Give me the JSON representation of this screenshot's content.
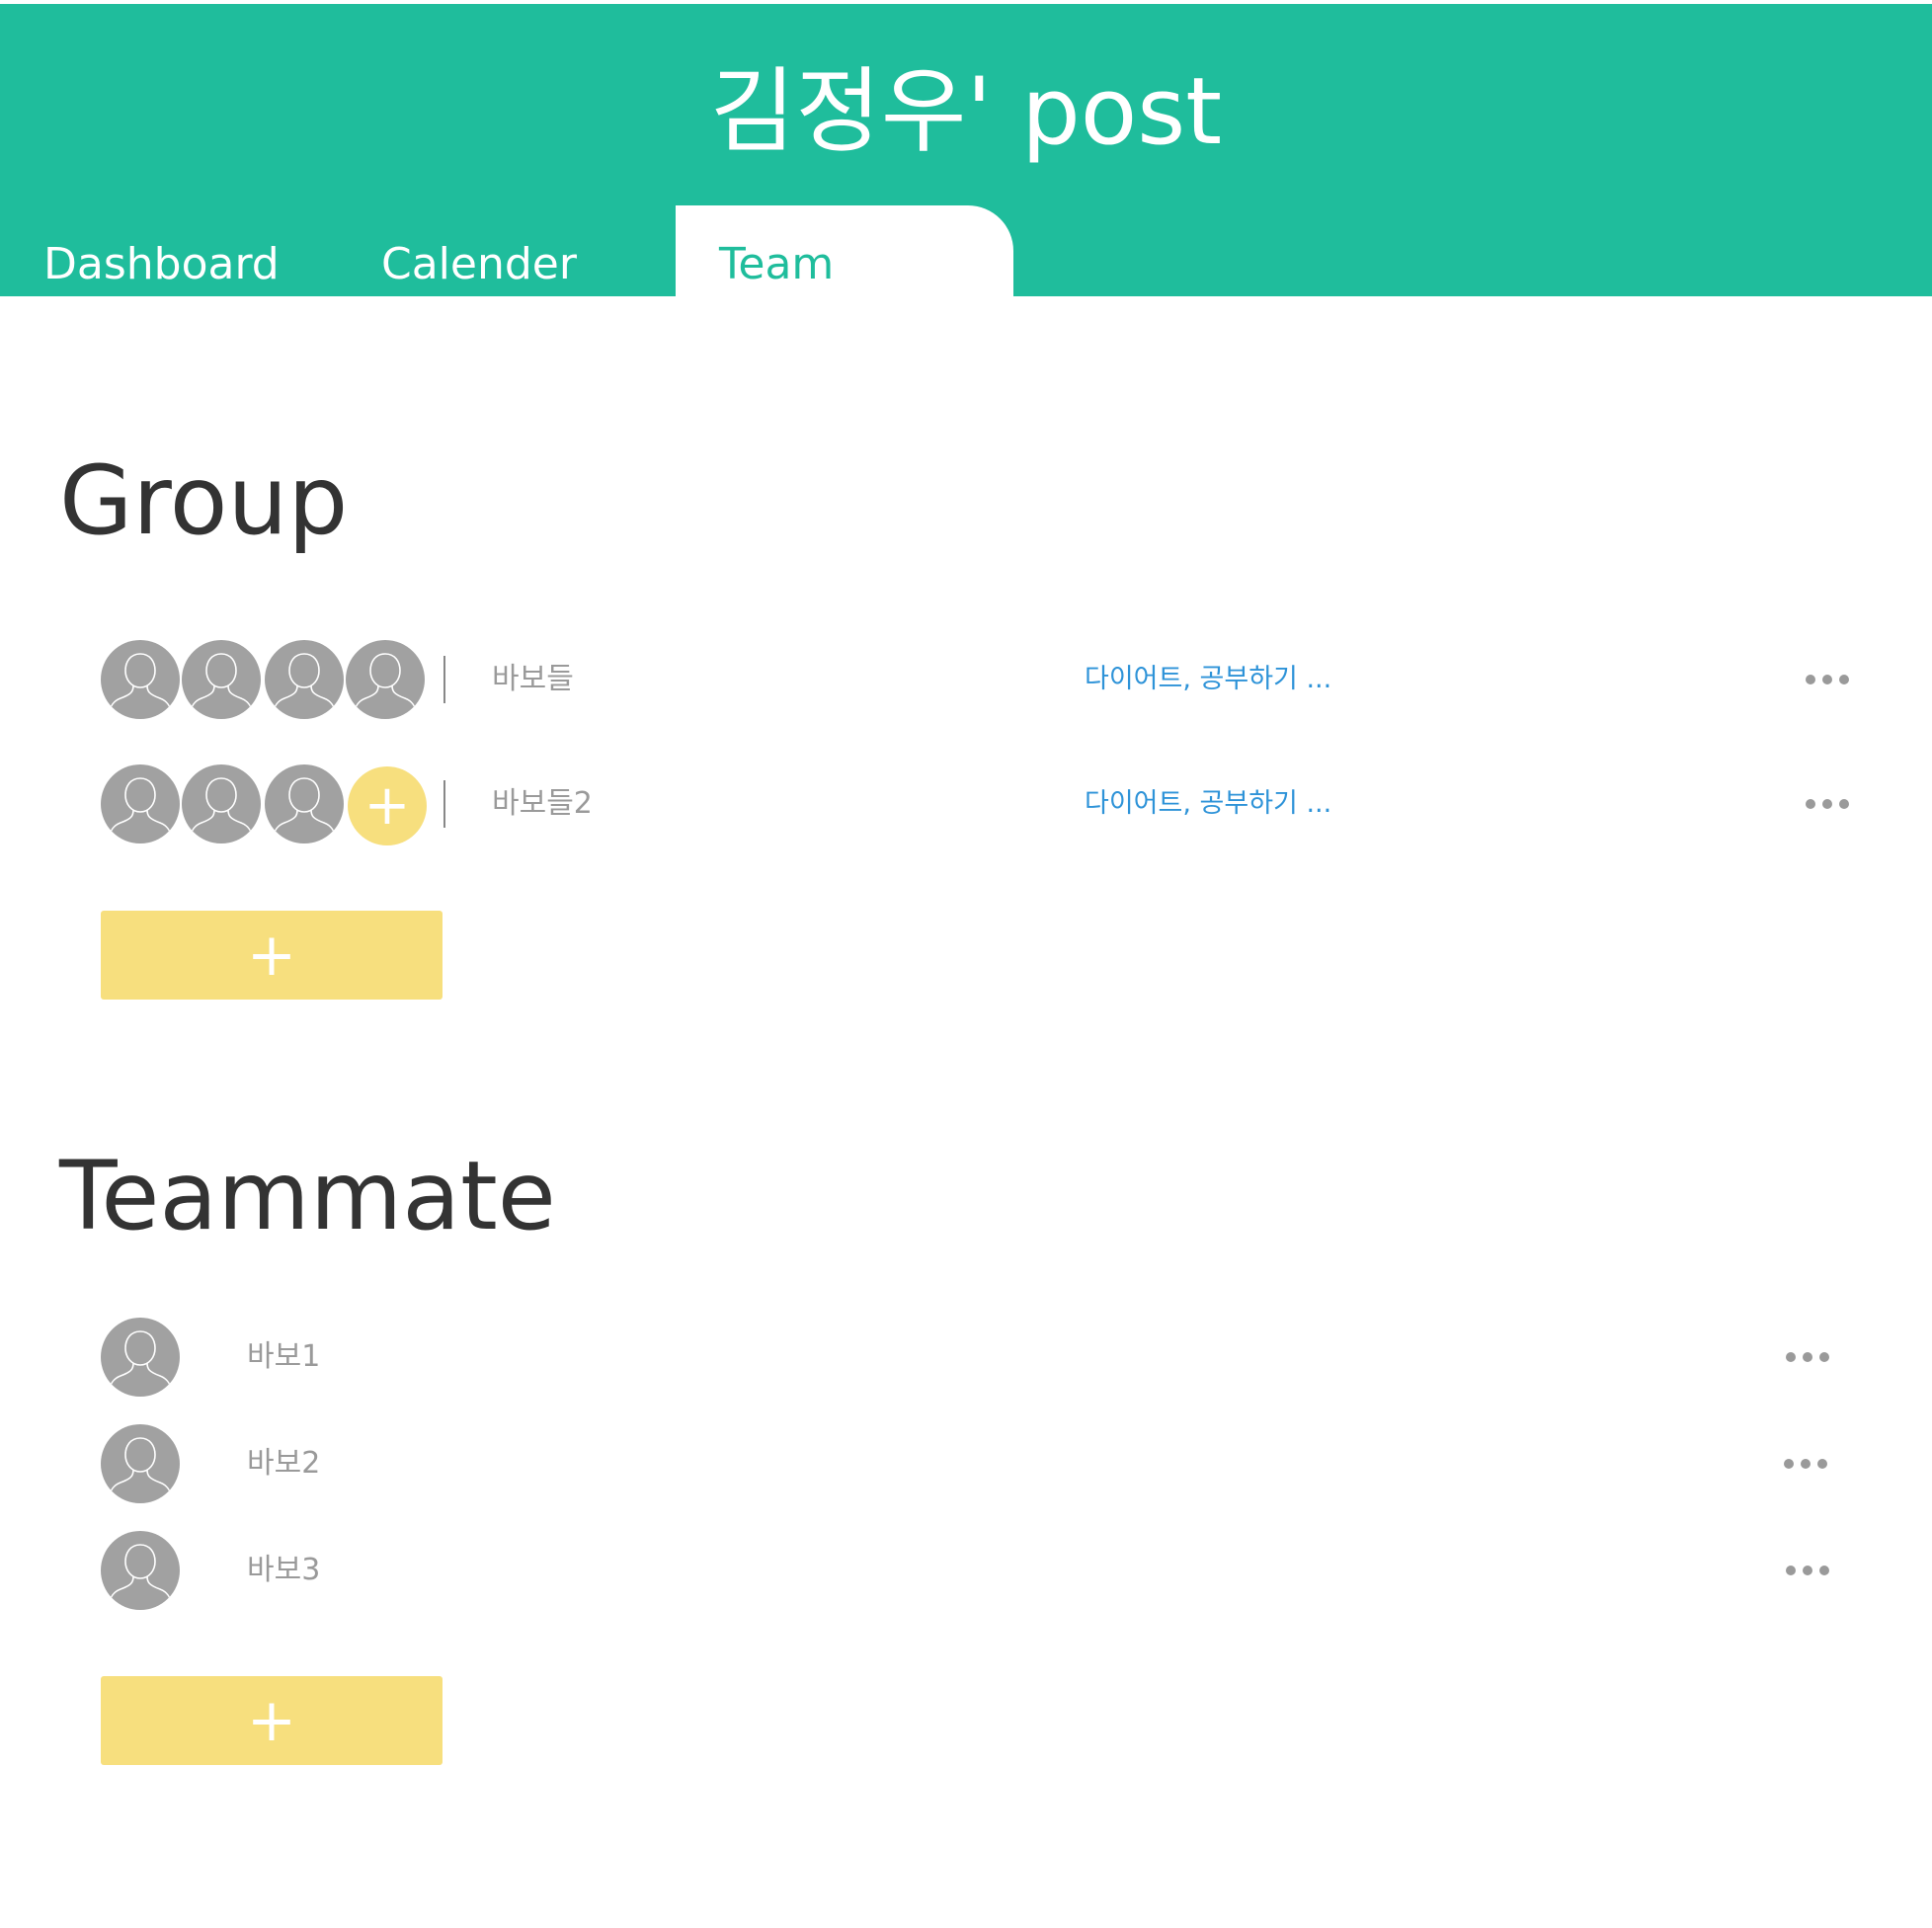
{
  "header": {
    "title": "김정우' post",
    "tabs": [
      {
        "label": "Dashboard",
        "active": false
      },
      {
        "label": "Calender",
        "active": false
      },
      {
        "label": "Team",
        "active": true
      }
    ]
  },
  "group": {
    "title": "Group",
    "rows": [
      {
        "name": "바보들",
        "tags": "다이어트, 공부하기 ...",
        "member_count": 4
      },
      {
        "name": "바보들2",
        "tags": "다이어트, 공부하기 ...",
        "member_count": 3,
        "add_member_label": "+"
      }
    ],
    "add_label": "+"
  },
  "teammate": {
    "title": "Teammate",
    "rows": [
      {
        "name": "바보1"
      },
      {
        "name": "바보2"
      },
      {
        "name": "바보3"
      }
    ],
    "add_label": "+"
  },
  "colors": {
    "brand": "#1fbd9c",
    "accent_yellow": "#f7df7e",
    "avatar_gray": "#a1a1a1",
    "link_blue": "#2e93d8"
  },
  "icons": {
    "avatar": "user-silhouette-icon",
    "more": "more-horizontal-icon",
    "add": "plus-icon"
  }
}
